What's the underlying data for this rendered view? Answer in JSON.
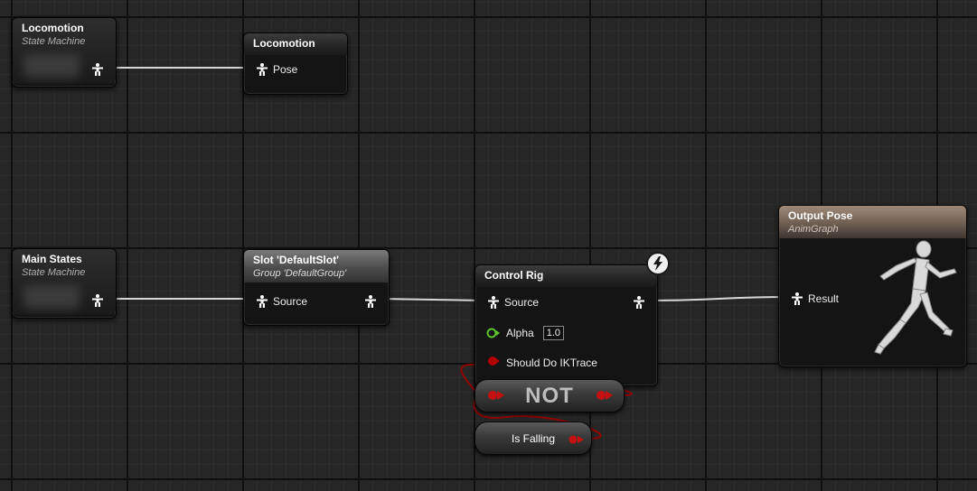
{
  "nodes": {
    "locomotion_sm": {
      "title": "Locomotion",
      "subtitle": "State Machine"
    },
    "locomotion_ref": {
      "title": "Locomotion",
      "pin_pose": "Pose"
    },
    "main_states": {
      "title": "Main States",
      "subtitle": "State Machine"
    },
    "slot": {
      "title": "Slot 'DefaultSlot'",
      "subtitle": "Group 'DefaultGroup'",
      "pin_source": "Source"
    },
    "control_rig": {
      "title": "Control Rig",
      "pin_source": "Source",
      "pin_alpha": "Alpha",
      "alpha_value": "1.0",
      "pin_should_do_iktrace": "Should Do IKTrace"
    },
    "not_node": {
      "label": "NOT"
    },
    "is_falling": {
      "label": "Is Falling"
    },
    "output_pose": {
      "title": "Output Pose",
      "subtitle": "AnimGraph",
      "pin_result": "Result"
    }
  },
  "icons": {
    "pose_pin": "pose-person-icon",
    "float_pin": "float-pin-icon",
    "bool_pin": "bool-pin-icon",
    "control_rig_badge": "lightning-bolt-icon",
    "output_preview": "running-mannequin-icon"
  },
  "colors": {
    "wire_pose": "#d8d8d8",
    "wire_bool": "#a00000",
    "float_pin": "#5ec22e",
    "output_header": "#8a7666",
    "slot_header": "#6a6a6a"
  }
}
